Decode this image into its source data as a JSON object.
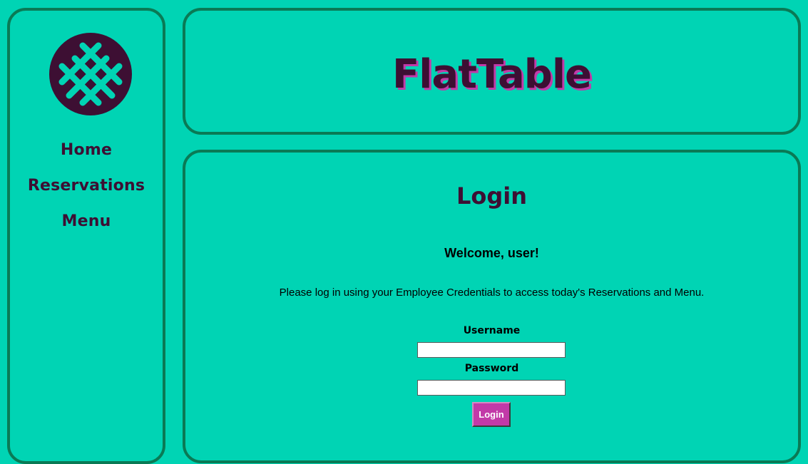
{
  "brand": {
    "name": "FlatTable"
  },
  "nav": {
    "items": [
      {
        "label": "Home"
      },
      {
        "label": "Reservations"
      },
      {
        "label": "Menu"
      }
    ]
  },
  "login": {
    "title": "Login",
    "welcome": "Welcome, user!",
    "instructions": "Please log in using your Employee Credentials to access today's Reservations and Menu.",
    "username_label": "Username",
    "username_value": "",
    "password_label": "Password",
    "password_value": "",
    "button_label": "Login"
  },
  "colors": {
    "background": "#00d4b4",
    "border": "#0a7a55",
    "primary_dark": "#3d0f33",
    "accent": "#c23aa8"
  },
  "icons": {
    "logo": "waffle-grid-icon"
  }
}
